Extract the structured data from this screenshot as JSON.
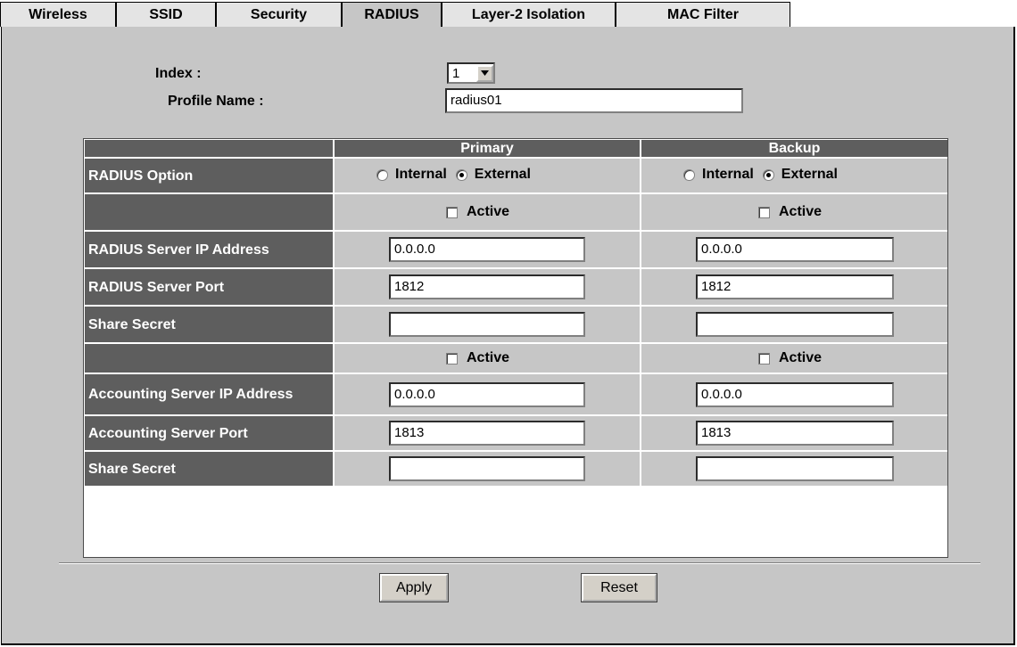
{
  "tabs": [
    {
      "label": "Wireless"
    },
    {
      "label": "SSID"
    },
    {
      "label": "Security"
    },
    {
      "label": "RADIUS"
    },
    {
      "label": "Layer-2 Isolation"
    },
    {
      "label": "MAC Filter"
    }
  ],
  "form": {
    "index_label": "Index :",
    "index_value": "1",
    "profile_label": "Profile Name :",
    "profile_value": "radius01"
  },
  "table": {
    "col_primary": "Primary",
    "col_backup": "Backup",
    "radius_option_label": "RADIUS Option",
    "opt_internal": "Internal",
    "opt_external": "External",
    "active_label": "Active",
    "rows": {
      "radius_ip": "RADIUS Server IP Address",
      "radius_port": "RADIUS Server Port",
      "share_secret": "Share Secret",
      "acct_ip": "Accounting Server IP Address",
      "acct_port": "Accounting Server Port",
      "acct_secret": "Share Secret"
    },
    "primary": {
      "radius_ip": "0.0.0.0",
      "radius_port": "1812",
      "share_secret": "",
      "acct_ip": "0.0.0.0",
      "acct_port": "1813",
      "acct_secret": ""
    },
    "backup": {
      "radius_ip": "0.0.0.0",
      "radius_port": "1812",
      "share_secret": "",
      "acct_ip": "0.0.0.0",
      "acct_port": "1813",
      "acct_secret": ""
    }
  },
  "buttons": {
    "apply": "Apply",
    "reset": "Reset"
  }
}
